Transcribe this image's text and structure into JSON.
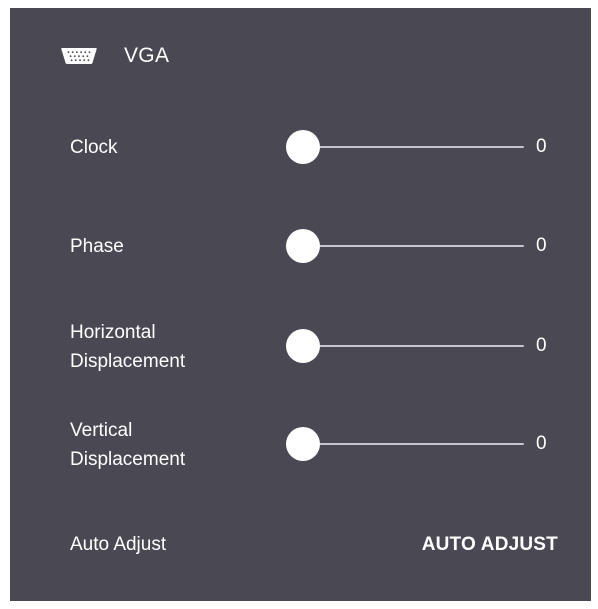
{
  "panel": {
    "title": "VGA",
    "title_icon": "vga-connector-icon",
    "background_color": "#4a4853"
  },
  "settings": [
    {
      "id": "clock",
      "label_lines": [
        "Clock"
      ],
      "value": "0",
      "level": 0
    },
    {
      "id": "phase",
      "label_lines": [
        "Phase"
      ],
      "value": "0",
      "level": 0
    },
    {
      "id": "horizontal-displacement",
      "label_lines": [
        "Horizontal",
        "Displacement"
      ],
      "value": "0",
      "level": 0
    },
    {
      "id": "vertical-displacement",
      "label_lines": [
        "Vertical",
        "Displacement"
      ],
      "value": "0",
      "level": 0
    }
  ],
  "auto_adjust": {
    "label": "Auto Adjust",
    "button_label": "AUTO ADJUST"
  }
}
